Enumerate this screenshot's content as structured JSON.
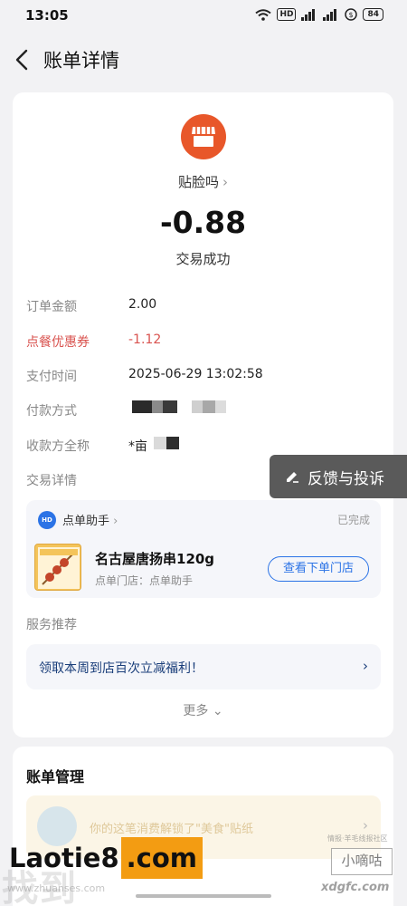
{
  "status_bar": {
    "time": "13:05",
    "hd_label": "HD",
    "signal_label": "5G",
    "battery": "84"
  },
  "header": {
    "title": "账单详情",
    "back_icon": "chevron-left-icon"
  },
  "summary": {
    "merchant_icon": "store-icon",
    "merchant_name": "贴脸吗",
    "amount": "-0.88",
    "status": "交易成功"
  },
  "details": {
    "order_amount_label": "订单金额",
    "order_amount_value": "2.00",
    "coupon_label": "点餐优惠券",
    "coupon_value": "-1.12",
    "pay_time_label": "支付时间",
    "pay_time_value": "2025-06-29 13:02:58",
    "pay_method_label": "付款方式",
    "payee_label": "收款方全称",
    "payee_value": "*亩",
    "trade_detail_label": "交易详情"
  },
  "feedback": {
    "label": "反馈与投诉",
    "icon": "edit-icon"
  },
  "order": {
    "helper_icon_text": "HD",
    "helper_name": "点单助手",
    "status": "已完成",
    "product_name": "名古屋唐扬串120g",
    "store": "点单门店：点单助手",
    "view_store_button": "查看下单门店"
  },
  "services": {
    "label": "服务推荐",
    "promo_text": "领取本周到店百次立减福利！",
    "more": "更多"
  },
  "bill_management": {
    "title": "账单管理",
    "banner_text": "你的这笔消费解锁了\"美食\"贴纸"
  },
  "watermarks": {
    "main_text": "Laotie8",
    "orange_text": ".com",
    "bg_text": "找到",
    "small_text": "www.zhuanses.com",
    "right_box": "小嘀咕",
    "right_top": "情报·羊毛线报社区",
    "right_url": "xdgfc.com"
  },
  "colors": {
    "accent_blue": "#2b73e6",
    "merchant_orange": "#e8572a",
    "coupon_red": "#d9534f"
  }
}
